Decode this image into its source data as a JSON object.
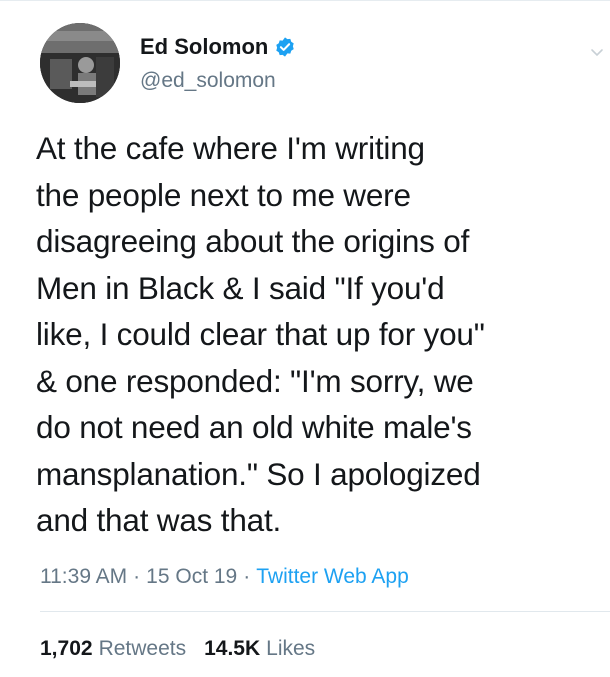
{
  "author": {
    "display_name": "Ed Solomon",
    "handle": "@ed_solomon",
    "verified_icon": "verified-badge-icon"
  },
  "tweet": {
    "text": "At the cafe where I'm writing\nthe people next to me were\ndisagreeing about the origins of\nMen in Black & I said \"If you'd\nlike, I could clear that up for you\"\n& one responded: \"I'm sorry, we\ndo not need an old white male's\nmansplanation.\" So I apologized\nand that was that."
  },
  "meta": {
    "time": "11:39 AM",
    "separator": "·",
    "date": "15 Oct 19",
    "source": "Twitter Web App"
  },
  "stats": {
    "retweets_count": "1,702",
    "retweets_label": "Retweets",
    "likes_count": "14.5K",
    "likes_label": "Likes"
  },
  "colors": {
    "accent": "#1da1f2",
    "secondary_text": "#657786",
    "primary_text": "#14171a"
  }
}
